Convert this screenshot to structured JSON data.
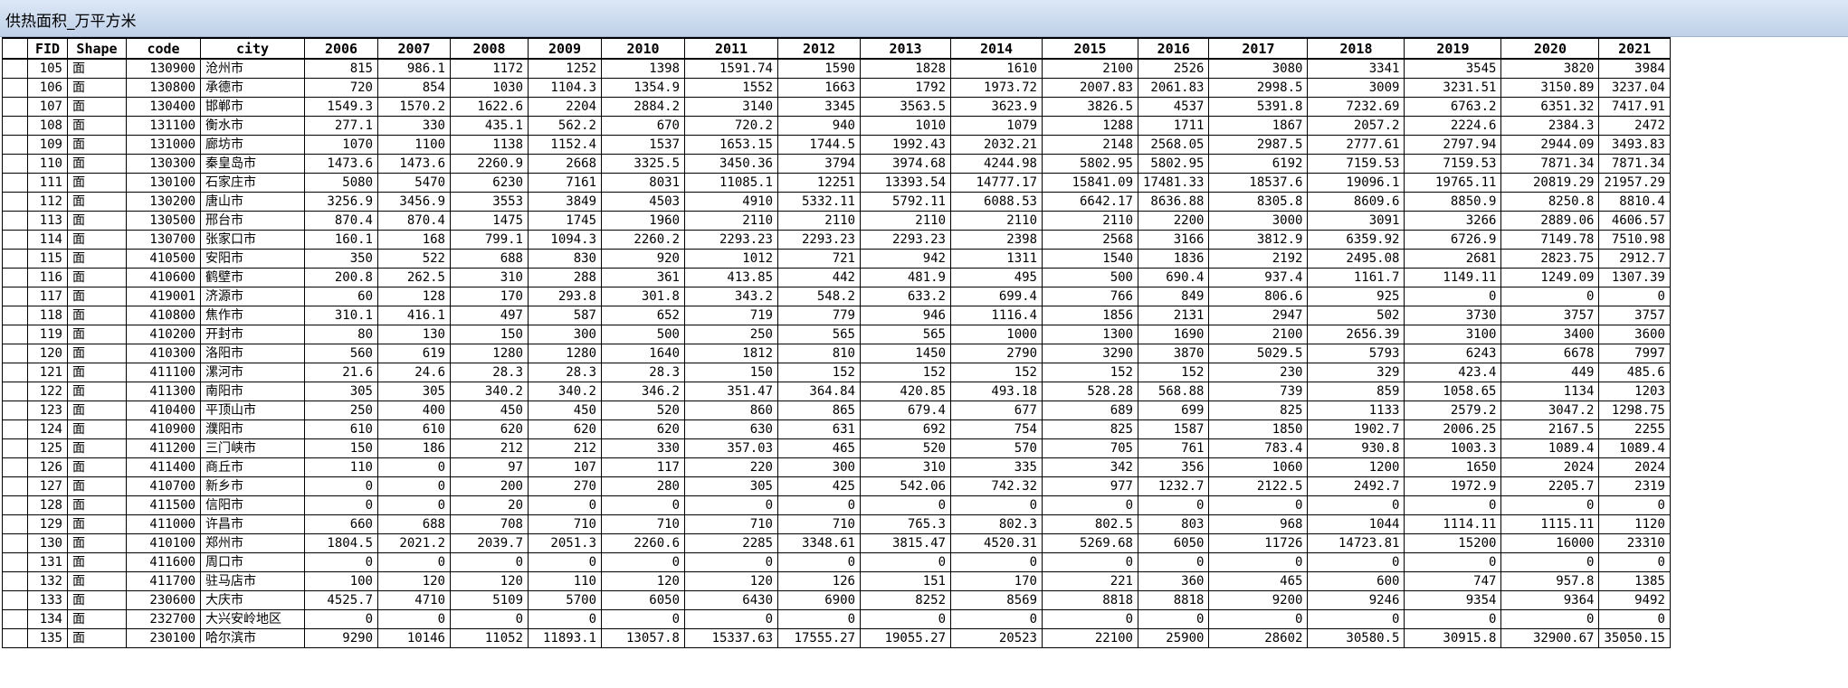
{
  "window": {
    "title": "供热面积_万平方米"
  },
  "table": {
    "columns": [
      "FID",
      "Shape",
      "code",
      "city",
      "2006",
      "2007",
      "2008",
      "2009",
      "2010",
      "2011",
      "2012",
      "2013",
      "2014",
      "2015",
      "2016",
      "2017",
      "2018",
      "2019",
      "2020",
      "2021"
    ],
    "rows": [
      [
        "105",
        "面",
        "130900",
        "沧州市",
        "815",
        "986.1",
        "1172",
        "1252",
        "1398",
        "1591.74",
        "1590",
        "1828",
        "1610",
        "2100",
        "2526",
        "3080",
        "3341",
        "3545",
        "3820",
        "3984"
      ],
      [
        "106",
        "面",
        "130800",
        "承德市",
        "720",
        "854",
        "1030",
        "1104.3",
        "1354.9",
        "1552",
        "1663",
        "1792",
        "1973.72",
        "2007.83",
        "2061.83",
        "2998.5",
        "3009",
        "3231.51",
        "3150.89",
        "3237.04"
      ],
      [
        "107",
        "面",
        "130400",
        "邯郸市",
        "1549.3",
        "1570.2",
        "1622.6",
        "2204",
        "2884.2",
        "3140",
        "3345",
        "3563.5",
        "3623.9",
        "3826.5",
        "4537",
        "5391.8",
        "7232.69",
        "6763.2",
        "6351.32",
        "7417.91"
      ],
      [
        "108",
        "面",
        "131100",
        "衡水市",
        "277.1",
        "330",
        "435.1",
        "562.2",
        "670",
        "720.2",
        "940",
        "1010",
        "1079",
        "1288",
        "1711",
        "1867",
        "2057.2",
        "2224.6",
        "2384.3",
        "2472"
      ],
      [
        "109",
        "面",
        "131000",
        "廊坊市",
        "1070",
        "1100",
        "1138",
        "1152.4",
        "1537",
        "1653.15",
        "1744.5",
        "1992.43",
        "2032.21",
        "2148",
        "2568.05",
        "2987.5",
        "2777.61",
        "2797.94",
        "2944.09",
        "3493.83"
      ],
      [
        "110",
        "面",
        "130300",
        "秦皇岛市",
        "1473.6",
        "1473.6",
        "2260.9",
        "2668",
        "3325.5",
        "3450.36",
        "3794",
        "3974.68",
        "4244.98",
        "5802.95",
        "5802.95",
        "6192",
        "7159.53",
        "7159.53",
        "7871.34",
        "7871.34"
      ],
      [
        "111",
        "面",
        "130100",
        "石家庄市",
        "5080",
        "5470",
        "6230",
        "7161",
        "8031",
        "11085.1",
        "12251",
        "13393.54",
        "14777.17",
        "15841.09",
        "17481.33",
        "18537.6",
        "19096.1",
        "19765.11",
        "20819.29",
        "21957.29"
      ],
      [
        "112",
        "面",
        "130200",
        "唐山市",
        "3256.9",
        "3456.9",
        "3553",
        "3849",
        "4503",
        "4910",
        "5332.11",
        "5792.11",
        "6088.53",
        "6642.17",
        "8636.88",
        "8305.8",
        "8609.6",
        "8850.9",
        "8250.8",
        "8810.4"
      ],
      [
        "113",
        "面",
        "130500",
        "邢台市",
        "870.4",
        "870.4",
        "1475",
        "1745",
        "1960",
        "2110",
        "2110",
        "2110",
        "2110",
        "2110",
        "2200",
        "3000",
        "3091",
        "3266",
        "2889.06",
        "4606.57"
      ],
      [
        "114",
        "面",
        "130700",
        "张家口市",
        "160.1",
        "168",
        "799.1",
        "1094.3",
        "2260.2",
        "2293.23",
        "2293.23",
        "2293.23",
        "2398",
        "2568",
        "3166",
        "3812.9",
        "6359.92",
        "6726.9",
        "7149.78",
        "7510.98"
      ],
      [
        "115",
        "面",
        "410500",
        "安阳市",
        "350",
        "522",
        "688",
        "830",
        "920",
        "1012",
        "721",
        "942",
        "1311",
        "1540",
        "1836",
        "2192",
        "2495.08",
        "2681",
        "2823.75",
        "2912.7"
      ],
      [
        "116",
        "面",
        "410600",
        "鹤壁市",
        "200.8",
        "262.5",
        "310",
        "288",
        "361",
        "413.85",
        "442",
        "481.9",
        "495",
        "500",
        "690.4",
        "937.4",
        "1161.7",
        "1149.11",
        "1249.09",
        "1307.39"
      ],
      [
        "117",
        "面",
        "419001",
        "济源市",
        "60",
        "128",
        "170",
        "293.8",
        "301.8",
        "343.2",
        "548.2",
        "633.2",
        "699.4",
        "766",
        "849",
        "806.6",
        "925",
        "0",
        "0",
        "0"
      ],
      [
        "118",
        "面",
        "410800",
        "焦作市",
        "310.1",
        "416.1",
        "497",
        "587",
        "652",
        "719",
        "779",
        "946",
        "1116.4",
        "1856",
        "2131",
        "2947",
        "502",
        "3730",
        "3757",
        "3757"
      ],
      [
        "119",
        "面",
        "410200",
        "开封市",
        "80",
        "130",
        "150",
        "300",
        "500",
        "250",
        "565",
        "565",
        "1000",
        "1300",
        "1690",
        "2100",
        "2656.39",
        "3100",
        "3400",
        "3600"
      ],
      [
        "120",
        "面",
        "410300",
        "洛阳市",
        "560",
        "619",
        "1280",
        "1280",
        "1640",
        "1812",
        "810",
        "1450",
        "2790",
        "3290",
        "3870",
        "5029.5",
        "5793",
        "6243",
        "6678",
        "7997"
      ],
      [
        "121",
        "面",
        "411100",
        "漯河市",
        "21.6",
        "24.6",
        "28.3",
        "28.3",
        "28.3",
        "150",
        "152",
        "152",
        "152",
        "152",
        "152",
        "230",
        "329",
        "423.4",
        "449",
        "485.6"
      ],
      [
        "122",
        "面",
        "411300",
        "南阳市",
        "305",
        "305",
        "340.2",
        "340.2",
        "346.2",
        "351.47",
        "364.84",
        "420.85",
        "493.18",
        "528.28",
        "568.88",
        "739",
        "859",
        "1058.65",
        "1134",
        "1203"
      ],
      [
        "123",
        "面",
        "410400",
        "平顶山市",
        "250",
        "400",
        "450",
        "450",
        "520",
        "860",
        "865",
        "679.4",
        "677",
        "689",
        "699",
        "825",
        "1133",
        "2579.2",
        "3047.2",
        "1298.75"
      ],
      [
        "124",
        "面",
        "410900",
        "濮阳市",
        "610",
        "610",
        "620",
        "620",
        "620",
        "630",
        "631",
        "692",
        "754",
        "825",
        "1587",
        "1850",
        "1902.7",
        "2006.25",
        "2167.5",
        "2255"
      ],
      [
        "125",
        "面",
        "411200",
        "三门峡市",
        "150",
        "186",
        "212",
        "212",
        "330",
        "357.03",
        "465",
        "520",
        "570",
        "705",
        "761",
        "783.4",
        "930.8",
        "1003.3",
        "1089.4",
        "1089.4"
      ],
      [
        "126",
        "面",
        "411400",
        "商丘市",
        "110",
        "0",
        "97",
        "107",
        "117",
        "220",
        "300",
        "310",
        "335",
        "342",
        "356",
        "1060",
        "1200",
        "1650",
        "2024",
        "2024"
      ],
      [
        "127",
        "面",
        "410700",
        "新乡市",
        "0",
        "0",
        "200",
        "270",
        "280",
        "305",
        "425",
        "542.06",
        "742.32",
        "977",
        "1232.7",
        "2122.5",
        "2492.7",
        "1972.9",
        "2205.7",
        "2319"
      ],
      [
        "128",
        "面",
        "411500",
        "信阳市",
        "0",
        "0",
        "20",
        "0",
        "0",
        "0",
        "0",
        "0",
        "0",
        "0",
        "0",
        "0",
        "0",
        "0",
        "0",
        "0"
      ],
      [
        "129",
        "面",
        "411000",
        "许昌市",
        "660",
        "688",
        "708",
        "710",
        "710",
        "710",
        "710",
        "765.3",
        "802.3",
        "802.5",
        "803",
        "968",
        "1044",
        "1114.11",
        "1115.11",
        "1120"
      ],
      [
        "130",
        "面",
        "410100",
        "郑州市",
        "1804.5",
        "2021.2",
        "2039.7",
        "2051.3",
        "2260.6",
        "2285",
        "3348.61",
        "3815.47",
        "4520.31",
        "5269.68",
        "6050",
        "11726",
        "14723.81",
        "15200",
        "16000",
        "23310"
      ],
      [
        "131",
        "面",
        "411600",
        "周口市",
        "0",
        "0",
        "0",
        "0",
        "0",
        "0",
        "0",
        "0",
        "0",
        "0",
        "0",
        "0",
        "0",
        "0",
        "0",
        "0"
      ],
      [
        "132",
        "面",
        "411700",
        "驻马店市",
        "100",
        "120",
        "120",
        "110",
        "120",
        "120",
        "126",
        "151",
        "170",
        "221",
        "360",
        "465",
        "600",
        "747",
        "957.8",
        "1385"
      ],
      [
        "133",
        "面",
        "230600",
        "大庆市",
        "4525.7",
        "4710",
        "5109",
        "5700",
        "6050",
        "6430",
        "6900",
        "8252",
        "8569",
        "8818",
        "8818",
        "9200",
        "9246",
        "9354",
        "9364",
        "9492"
      ],
      [
        "134",
        "面",
        "232700",
        "大兴安岭地区",
        "0",
        "0",
        "0",
        "0",
        "0",
        "0",
        "0",
        "0",
        "0",
        "0",
        "0",
        "0",
        "0",
        "0",
        "0",
        "0"
      ],
      [
        "135",
        "面",
        "230100",
        "哈尔滨市",
        "9290",
        "10146",
        "11052",
        "11893.1",
        "13057.8",
        "15337.63",
        "17555.27",
        "19055.27",
        "20523",
        "22100",
        "25900",
        "28602",
        "30580.5",
        "30915.8",
        "32900.67",
        "35050.15"
      ]
    ]
  }
}
